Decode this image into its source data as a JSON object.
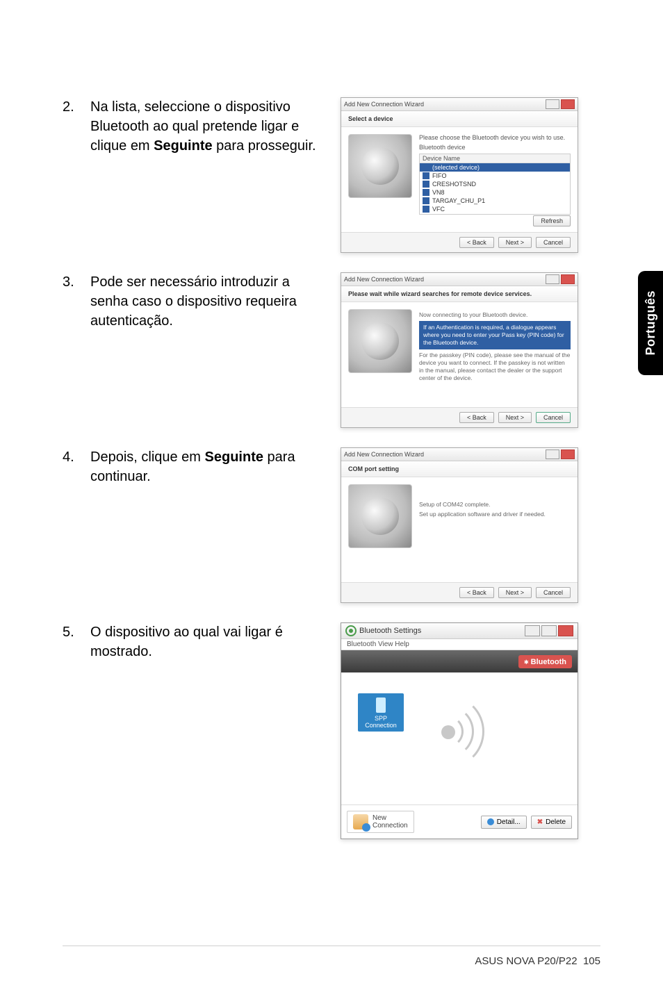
{
  "side_tab": "Português",
  "steps": [
    {
      "num": "2.",
      "text_plain": "Na lista, seleccione o dispositivo Bluetooth ao qual pretende ligar e clique em ",
      "text_bold": "Seguinte",
      "text_after": " para prosseguir."
    },
    {
      "num": "3.",
      "text_plain": "Pode ser necessário introduzir a senha caso o dispositivo requeira autenticação.",
      "text_bold": "",
      "text_after": ""
    },
    {
      "num": "4.",
      "text_plain": "Depois, clique em ",
      "text_bold": "Seguinte",
      "text_after": " para continuar."
    },
    {
      "num": "5.",
      "text_plain": "O dispositivo ao qual vai ligar é mostrado.",
      "text_bold": "",
      "text_after": ""
    }
  ],
  "dlg1": {
    "title": "Add New Connection Wizard",
    "banner": "Select a device",
    "prompt": "Please choose the Bluetooth device you wish to use.",
    "list_label": "Bluetooth device",
    "list_head": "Device Name",
    "items": [
      "(selected device)",
      "FIFO",
      "CRESHOTSND",
      "VN8",
      "TARGAY_CHU_P1",
      "VFC"
    ],
    "refresh": "Refresh",
    "back": "< Back",
    "next": "Next >",
    "cancel": "Cancel"
  },
  "dlg2": {
    "title": "Add New Connection Wizard",
    "banner": "Please wait while wizard searches for remote device services.",
    "line1": "Now connecting to your Bluetooth device.",
    "box": "If an Authentication is required, a dialogue appears where you need to enter your Pass key (PIN code) for the Bluetooth device.",
    "line2": "For the passkey (PIN code), please see the manual of the device you want to connect. If the passkey is not written in the manual, please contact the dealer or the support center of the device.",
    "back": "< Back",
    "next": "Next >",
    "cancel": "Cancel"
  },
  "dlg3": {
    "title": "Add New Connection Wizard",
    "banner": "COM port setting",
    "line1": "Setup of COM42 complete.",
    "line2": "Set up application software and driver if needed.",
    "back": "< Back",
    "next": "Next >",
    "cancel": "Cancel"
  },
  "bt": {
    "title": "Bluetooth Settings",
    "menu": "Bluetooth   View   Help",
    "badge": "Bluetooth",
    "spp_top": "SPP",
    "spp_bottom": "Connection",
    "new_top": "New",
    "new_bottom": "Connection",
    "detail": "Detail...",
    "delete": "Delete"
  },
  "footer": {
    "product": "ASUS NOVA P20/P22",
    "page": "105"
  }
}
